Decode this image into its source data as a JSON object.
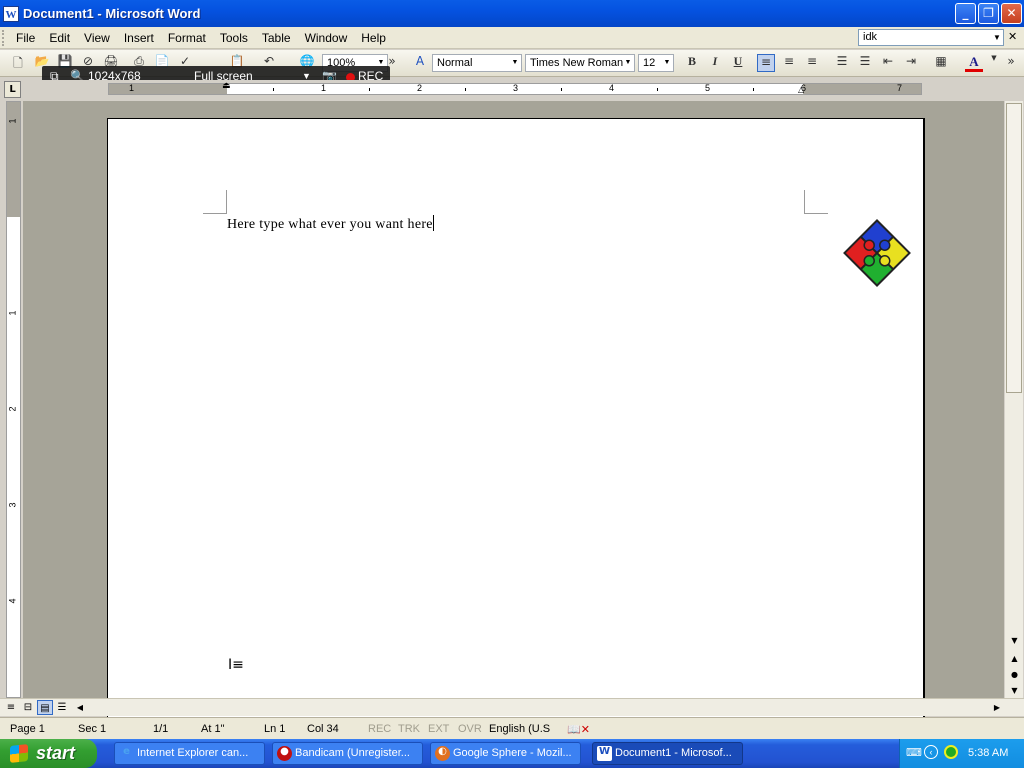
{
  "window": {
    "title": "Document1 - Microsoft Word",
    "app_icon": "word-icon",
    "controls": {
      "minimize": "minimize-icon",
      "maximize": "restore-icon",
      "close": "close-icon"
    }
  },
  "menu": {
    "items": [
      "File",
      "Edit",
      "View",
      "Insert",
      "Format",
      "Tools",
      "Table",
      "Window",
      "Help"
    ],
    "help_box_value": "idk"
  },
  "toolbar": {
    "zoom": "100%",
    "style": "Normal",
    "font": "Times New Roman",
    "size": "12",
    "bold": "B",
    "italic": "I",
    "underline": "U",
    "font_color": "A",
    "font_color_hex": "#e00000"
  },
  "recorder": {
    "resolution": "1024x768",
    "mode": "Full screen",
    "rec_label": "REC",
    "rec_dot_color": "#e01010"
  },
  "ruler": {
    "tab_selector": "L",
    "numbers": [
      "1",
      "1",
      "2",
      "3",
      "4",
      "5",
      "6",
      "7"
    ],
    "vertical_numbers": [
      "1",
      "1",
      "2",
      "3",
      "4"
    ]
  },
  "document": {
    "text": "Here type what ever you want here",
    "image": "puzzle-pieces-icon"
  },
  "status": {
    "page": "Page 1",
    "sec": "Sec 1",
    "pages": "1/1",
    "at": "At 1\"",
    "ln": "Ln 1",
    "col": "Col 34",
    "rec": "REC",
    "trk": "TRK",
    "ext": "EXT",
    "ovr": "OVR",
    "language": "English (U.S"
  },
  "taskbar": {
    "start": "start",
    "tasks": [
      {
        "label": "Internet Explorer can...",
        "icon": "internet-explorer-icon"
      },
      {
        "label": "Bandicam (Unregister...",
        "icon": "bandicam-icon"
      },
      {
        "label": "Google Sphere - Mozil...",
        "icon": "firefox-icon"
      },
      {
        "label": "Document1 - Microsof...",
        "icon": "word-icon"
      }
    ],
    "clock": "5:38 AM"
  }
}
